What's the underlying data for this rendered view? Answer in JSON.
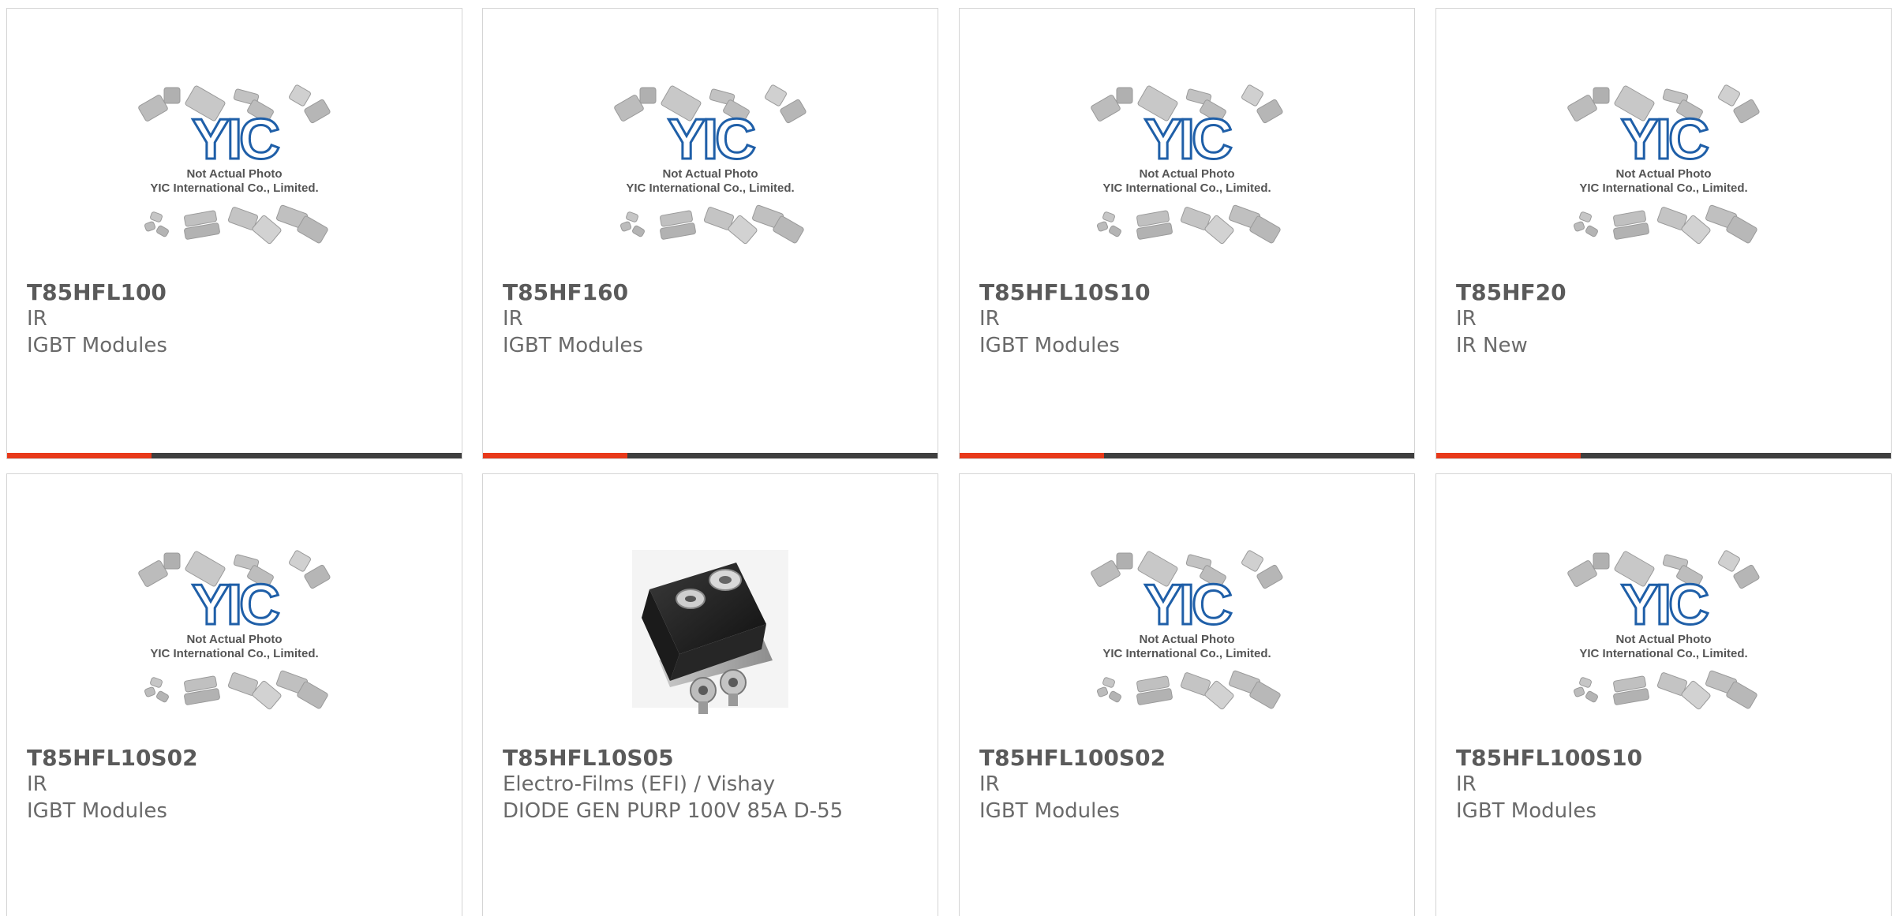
{
  "colors": {
    "accent": "#e8391a",
    "bar_dark": "#3f3f3f",
    "logo_blue": "#1f5fa8"
  },
  "placeholder_photo": {
    "line1": "Not Actual Photo",
    "line2": "YIC International Co., Limited.",
    "logo_text": "YIC"
  },
  "products": [
    {
      "part_number": "T85HFL100",
      "maker": "IR",
      "description": "IGBT Modules",
      "photo": "placeholder-photo-icon"
    },
    {
      "part_number": "T85HF160",
      "maker": "IR",
      "description": "IGBT Modules",
      "photo": "placeholder-photo-icon"
    },
    {
      "part_number": "T85HFL10S10",
      "maker": "IR",
      "description": "IGBT Modules",
      "photo": "placeholder-photo-icon"
    },
    {
      "part_number": "T85HF20",
      "maker": "IR",
      "description": "IR New",
      "photo": "placeholder-photo-icon"
    },
    {
      "part_number": "T85HFL10S02",
      "maker": "IR",
      "description": "IGBT Modules",
      "photo": "placeholder-photo-icon"
    },
    {
      "part_number": "T85HFL10S05",
      "maker": "Electro-Films (EFI) / Vishay",
      "description": "DIODE GEN PURP 100V 85A D-55",
      "photo": "diode-module-photo"
    },
    {
      "part_number": "T85HFL100S02",
      "maker": "IR",
      "description": "IGBT Modules",
      "photo": "placeholder-photo-icon"
    },
    {
      "part_number": "T85HFL100S10",
      "maker": "IR",
      "description": "IGBT Modules",
      "photo": "placeholder-photo-icon"
    }
  ]
}
